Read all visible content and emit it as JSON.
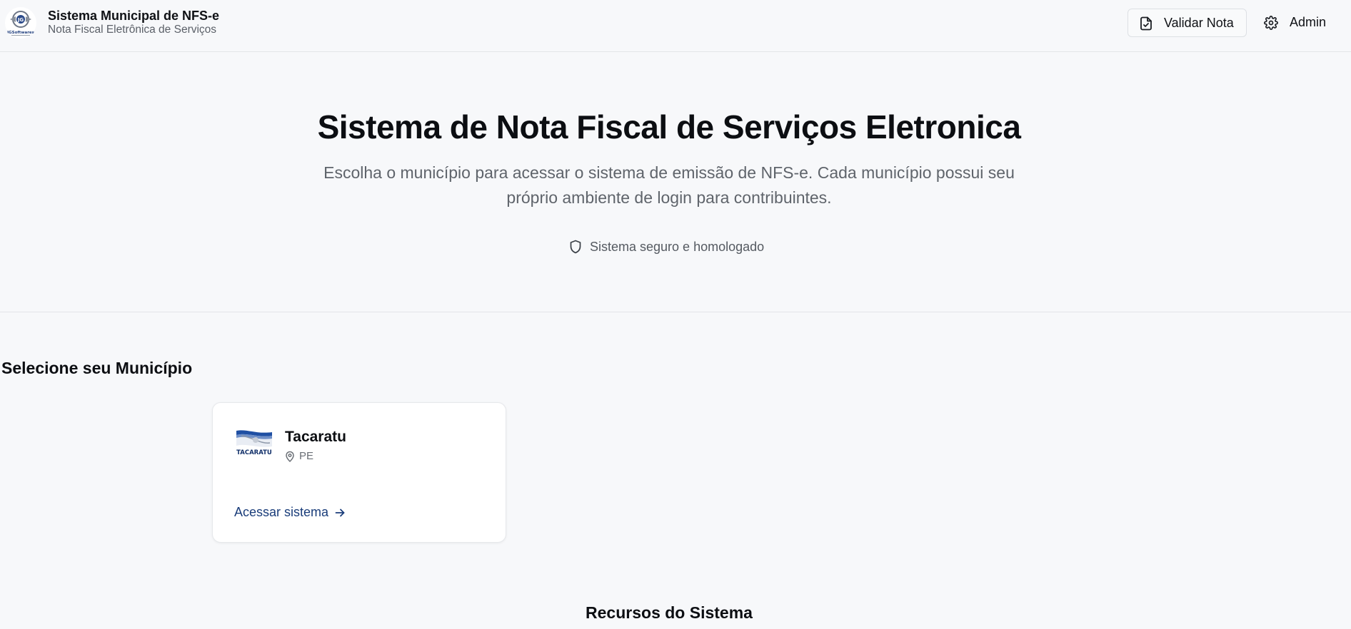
{
  "header": {
    "brand_title": "Sistema Municipal de NFS-e",
    "brand_subtitle": "Nota Fiscal Eletrônica de Serviços",
    "logo_text": "JGSoftwares",
    "validar_label": "Validar Nota",
    "admin_label": "Admin"
  },
  "hero": {
    "title": "Sistema de Nota Fiscal de Serviços Eletronica",
    "description": "Escolha o município para acessar o sistema de emissão de NFS-e. Cada município possui seu próprio ambiente de login para contribuintes.",
    "secure_label": "Sistema seguro e homologado"
  },
  "municipalities": {
    "section_title": "Selecione seu Município",
    "items": [
      {
        "name": "Tacaratu",
        "state": "PE",
        "flag_text": "TACARATU",
        "access_label": "Acessar sistema"
      }
    ]
  },
  "resources": {
    "title": "Recursos do Sistema"
  },
  "colors": {
    "background": "#f7f8fa",
    "accent_link": "#1a3d7a",
    "border": "#e3e5e8"
  },
  "icons": {
    "validar": "file-check-icon",
    "admin": "gear-icon",
    "secure": "shield-icon",
    "location": "map-pin-icon",
    "access": "arrow-right-icon"
  }
}
